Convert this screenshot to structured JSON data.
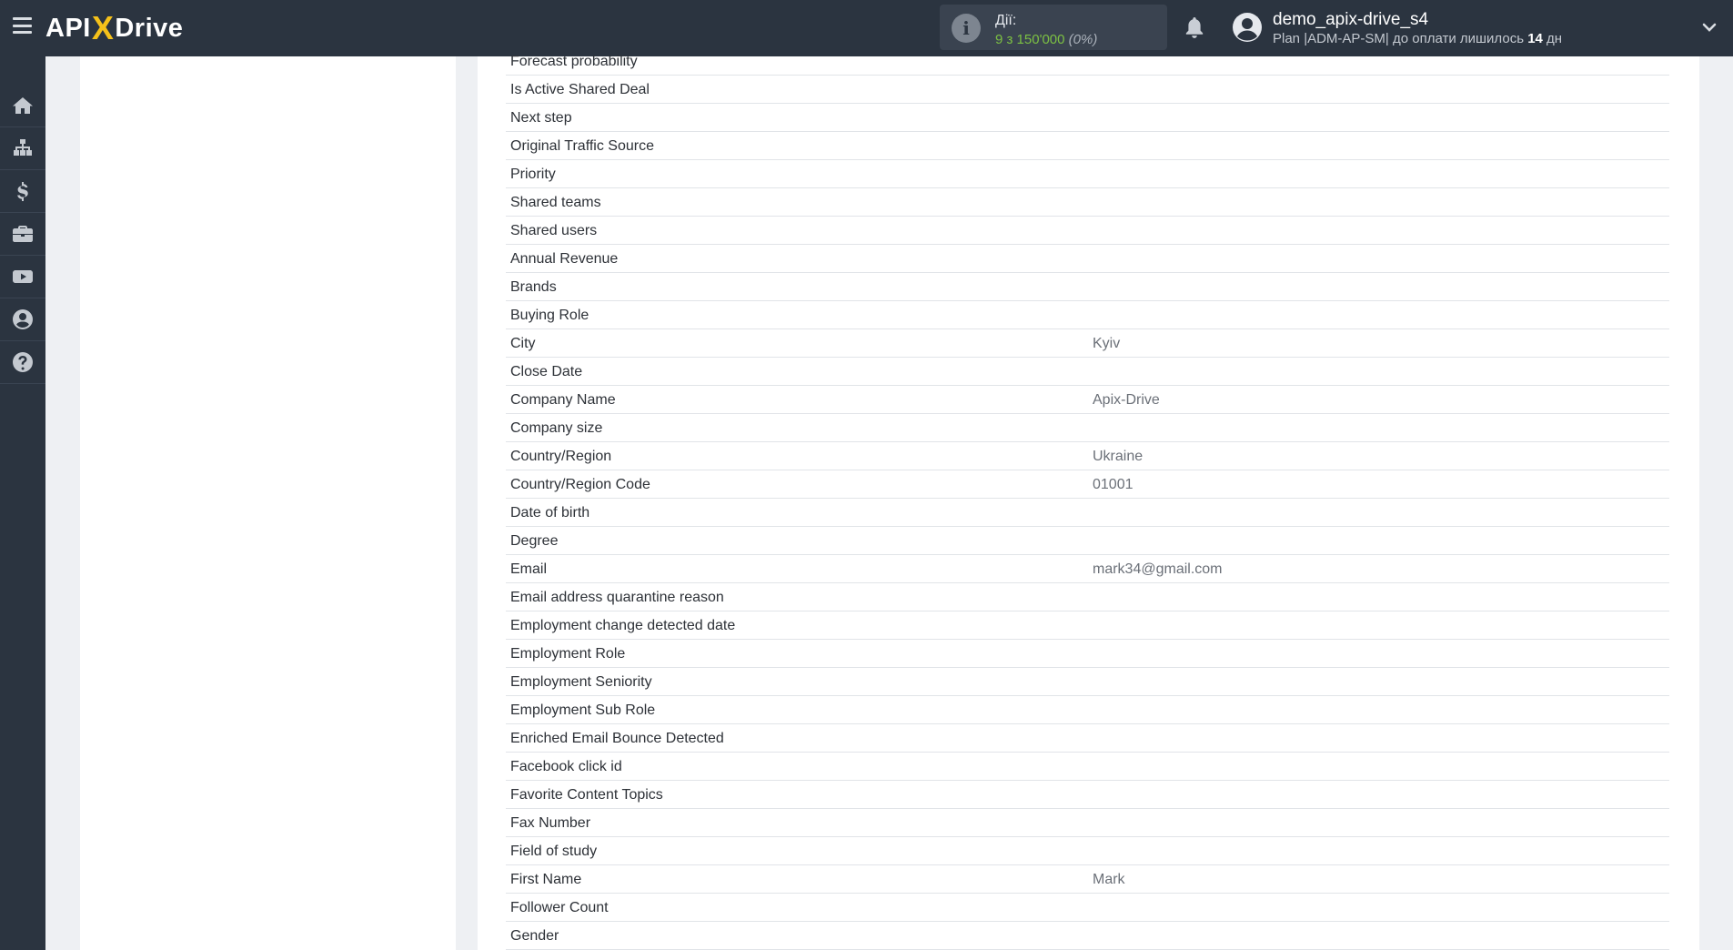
{
  "header": {
    "logo": {
      "part1": "API",
      "part2": "X",
      "part3": "Drive"
    },
    "actions": {
      "label": "Дії:",
      "value": "9 з 150'000",
      "percent": "(0%)"
    },
    "user": {
      "name": "demo_apix-drive_s4",
      "plan_prefix": "Plan |ADM-AP-SM| до оплати лишилось ",
      "days": "14",
      "days_suffix": " дн"
    }
  },
  "sidebar": {
    "items": [
      {
        "name": "home",
        "icon": "home-icon"
      },
      {
        "name": "connections",
        "icon": "sitemap-icon"
      },
      {
        "name": "billing",
        "icon": "dollar-icon"
      },
      {
        "name": "tools",
        "icon": "briefcase-icon"
      },
      {
        "name": "video",
        "icon": "youtube-icon"
      },
      {
        "name": "account",
        "icon": "user-circle-icon"
      },
      {
        "name": "help",
        "icon": "question-circle-icon"
      }
    ]
  },
  "fields": [
    {
      "name": "Forecast probability",
      "value": ""
    },
    {
      "name": "Is Active Shared Deal",
      "value": ""
    },
    {
      "name": "Next step",
      "value": ""
    },
    {
      "name": "Original Traffic Source",
      "value": ""
    },
    {
      "name": "Priority",
      "value": ""
    },
    {
      "name": "Shared teams",
      "value": ""
    },
    {
      "name": "Shared users",
      "value": ""
    },
    {
      "name": "Annual Revenue",
      "value": ""
    },
    {
      "name": "Brands",
      "value": ""
    },
    {
      "name": "Buying Role",
      "value": ""
    },
    {
      "name": "City",
      "value": "Kyiv"
    },
    {
      "name": "Close Date",
      "value": ""
    },
    {
      "name": "Company Name",
      "value": "Apix-Drive"
    },
    {
      "name": "Company size",
      "value": ""
    },
    {
      "name": "Country/Region",
      "value": "Ukraine"
    },
    {
      "name": "Country/Region Code",
      "value": "01001"
    },
    {
      "name": "Date of birth",
      "value": ""
    },
    {
      "name": "Degree",
      "value": ""
    },
    {
      "name": "Email",
      "value": "mark34@gmail.com"
    },
    {
      "name": "Email address quarantine reason",
      "value": ""
    },
    {
      "name": "Employment change detected date",
      "value": ""
    },
    {
      "name": "Employment Role",
      "value": ""
    },
    {
      "name": "Employment Seniority",
      "value": ""
    },
    {
      "name": "Employment Sub Role",
      "value": ""
    },
    {
      "name": "Enriched Email Bounce Detected",
      "value": ""
    },
    {
      "name": "Facebook click id",
      "value": ""
    },
    {
      "name": "Favorite Content Topics",
      "value": ""
    },
    {
      "name": "Fax Number",
      "value": ""
    },
    {
      "name": "Field of study",
      "value": ""
    },
    {
      "name": "First Name",
      "value": "Mark"
    },
    {
      "name": "Follower Count",
      "value": ""
    },
    {
      "name": "Gender",
      "value": ""
    }
  ]
}
